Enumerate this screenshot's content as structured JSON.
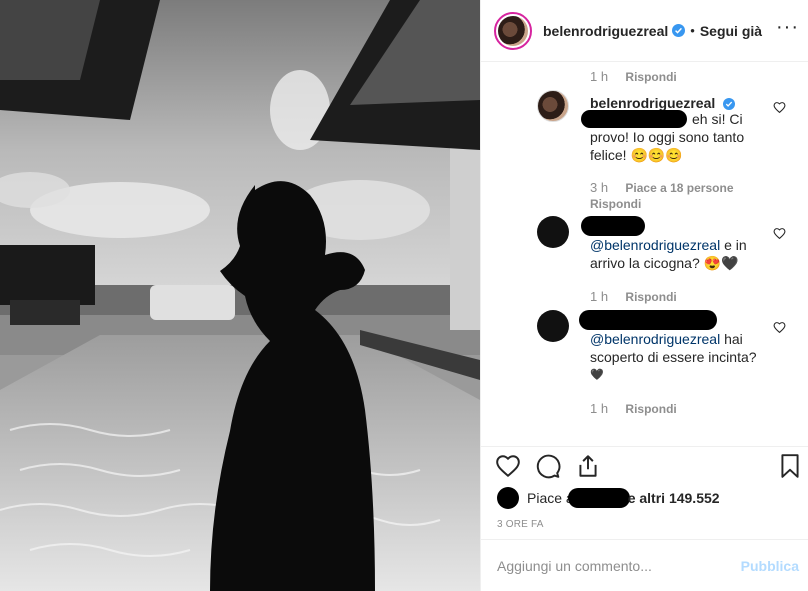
{
  "header": {
    "username": "belenrodriguezreal",
    "separator": "•",
    "follow_label": "Segui già",
    "more_label": "···"
  },
  "comments": [
    {
      "id": "top-meta",
      "time": "1 h",
      "reply": "Rispondi"
    },
    {
      "id": "owner-reply",
      "username": "belenrodriguezreal",
      "text_1": "eh si! Ci",
      "text_2": "provo! Io oggi sono tanto",
      "text_3": "felice! 😊😊😊",
      "time": "3 h",
      "likes": "Piace a 18 persone",
      "reply": "Rispondi"
    },
    {
      "id": "stork",
      "mention": "@belenrodriguezreal",
      "text_1": "e in",
      "text_2": "arrivo la cicogna? 😍🖤",
      "time": "1 h",
      "reply": "Rispondi"
    },
    {
      "id": "pregnant",
      "mention": "@belenrodriguezreal",
      "text_1": "hai",
      "text_2": "scoperto di essere incinta?",
      "text_3": "🖤",
      "time": "1 h",
      "reply": "Rispondi"
    }
  ],
  "actions": {
    "likes_prefix": "Piace a",
    "likes_suffix": "e altri 149.552",
    "timestamp": "3 ORE FA"
  },
  "composer": {
    "placeholder": "Aggiungi un commento...",
    "publish_label": "Pubblica"
  },
  "colors": {
    "link": "#003569",
    "muted": "#8e8e8e",
    "verified": "#3897f0",
    "publish_disabled": "#b3dbff"
  }
}
